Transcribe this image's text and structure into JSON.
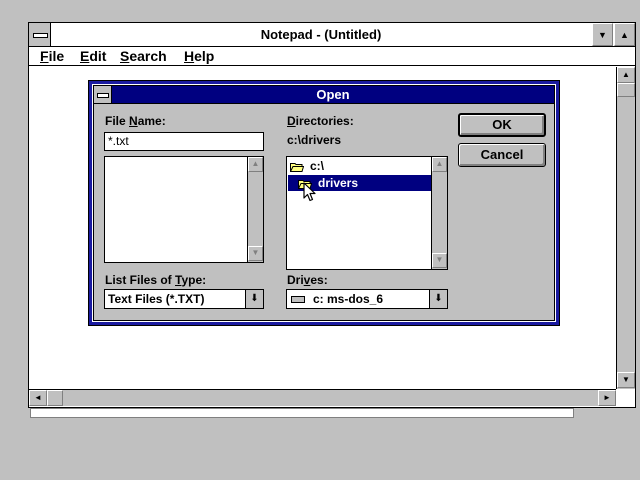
{
  "notepad": {
    "title": "Notepad - (Untitled)",
    "menu": [
      {
        "label": "File",
        "accel": "F",
        "rest": "ile"
      },
      {
        "label": "Edit",
        "accel": "E",
        "rest": "dit"
      },
      {
        "label": "Search",
        "accel": "S",
        "rest": "earch"
      },
      {
        "label": "Help",
        "accel": "H",
        "rest": "elp"
      }
    ]
  },
  "dialog": {
    "title": "Open",
    "file_name_label": {
      "pre": "File ",
      "accel": "N",
      "post": "ame:"
    },
    "file_name_value": "*.txt",
    "directories_label": {
      "accel": "D",
      "post": "irectories:"
    },
    "current_dir": "c:\\drivers",
    "dir_items": [
      {
        "label": "c:\\",
        "selected": false
      },
      {
        "label": "drivers",
        "selected": true
      }
    ],
    "list_type_label": {
      "pre": "List Files of ",
      "accel": "T",
      "post": "ype:"
    },
    "list_type_value": "Text Files (*.TXT)",
    "drives_label": {
      "pre": "Dri",
      "accel": "v",
      "post": "es:"
    },
    "drive_value": "c: ms-dos_6",
    "ok_label": "OK",
    "cancel_label": "Cancel"
  },
  "icons": {
    "scroll_up": "▲",
    "scroll_down": "▼",
    "scroll_left": "◄",
    "scroll_right": "►",
    "combo_drop": "⬇"
  },
  "colors": {
    "title_active": "#000080",
    "selection": "#000080",
    "face": "#c0c0c0"
  }
}
